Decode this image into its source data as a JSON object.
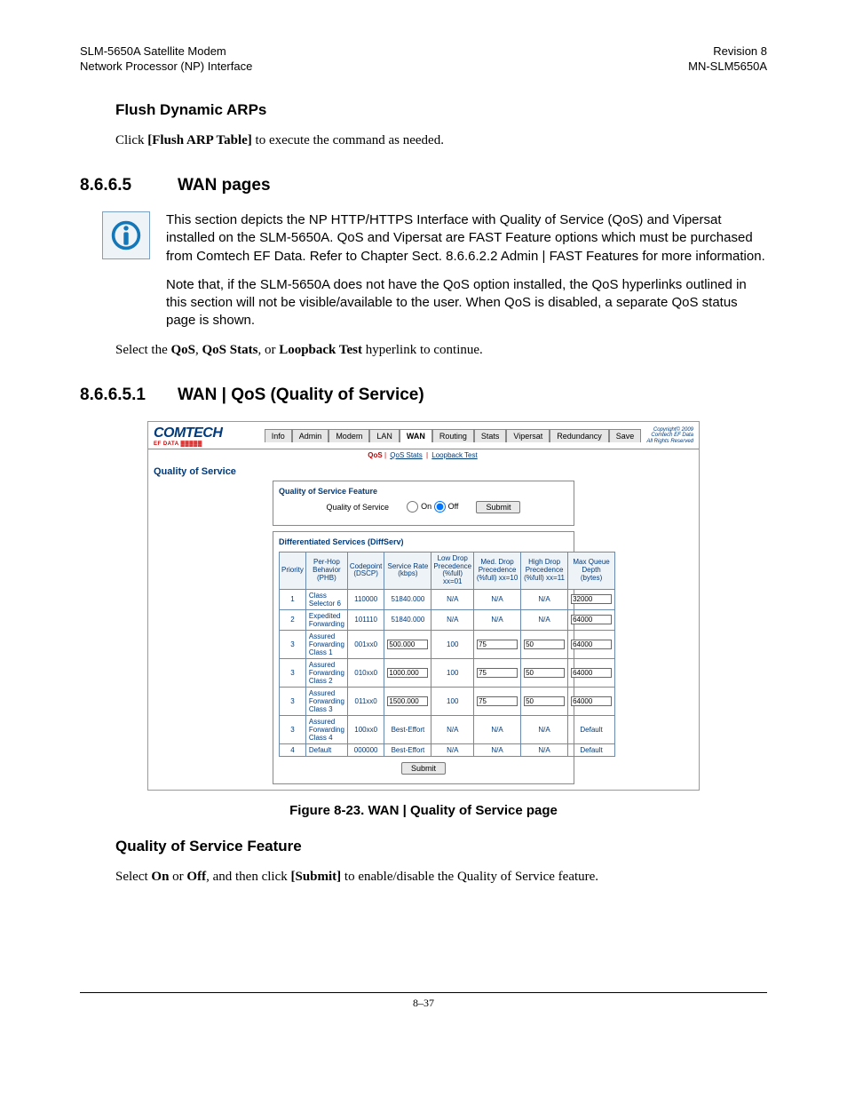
{
  "header": {
    "left1": "SLM-5650A Satellite Modem",
    "left2": "Network Processor (NP) Interface",
    "right1": "Revision 8",
    "right2": "MN-SLM5650A"
  },
  "sec1": {
    "h_flush": "Flush Dynamic ARPs",
    "p_flush_a": "Click ",
    "p_flush_b": "[Flush ARP Table]",
    "p_flush_c": " to execute the command as needed."
  },
  "sec2": {
    "num": "8.6.6.5",
    "title": "WAN pages",
    "info1": "This section depicts the NP HTTP/HTTPS Interface with Quality of Service (QoS) and Vipersat installed on the SLM-5650A. QoS and Vipersat are FAST Feature options which must be purchased from Comtech EF Data. Refer to Chapter Sect. 8.6.6.2.2 Admin | FAST Features for more information.",
    "info2": "Note that, if the SLM-5650A does not have the QoS option installed, the QoS hyperlinks outlined in this section will not be visible/available to the user. When QoS is disabled, a separate QoS status page is shown.",
    "select_a": "Select the ",
    "select_b": "QoS",
    "select_c": ", ",
    "select_d": "QoS Stats",
    "select_e": ", or ",
    "select_f": "Loopback Test",
    "select_g": " hyperlink to continue."
  },
  "sec3": {
    "num": "8.6.6.5.1",
    "title": "WAN | QoS (Quality of Service)"
  },
  "ss": {
    "logo": "COMTECH",
    "logo_sub": "EF DATA ▓▓▓▓▓",
    "tabs": [
      "Info",
      "Admin",
      "Modem",
      "LAN",
      "WAN",
      "Routing",
      "Stats",
      "Vipersat",
      "Redundancy",
      "Save"
    ],
    "active_tab": "WAN",
    "copy1": "Copyright© 2009",
    "copy2": "Comtech EF Data",
    "copy3": "All Rights Reserved",
    "subnav": {
      "active": "QoS",
      "links": [
        "QoS Stats",
        "Loopback Test"
      ]
    },
    "qos_title": "Quality of Service",
    "feature": {
      "heading": "Quality of Service Feature",
      "label": "Quality of Service",
      "on": "On",
      "off": "Off",
      "submit": "Submit"
    },
    "diffserv": {
      "heading": "Differentiated Services (DiffServ)",
      "cols": [
        "Priority",
        "Per-Hop Behavior (PHB)",
        "Codepoint (DSCP)",
        "Service Rate (kbps)",
        "Low Drop Precedence (%full) xx=01",
        "Med. Drop Precedence (%full) xx=10",
        "High Drop Precedence (%full) xx=11",
        "Max Queue Depth (bytes)"
      ],
      "rows": [
        {
          "pri": "1",
          "phb": "Class Selector 6",
          "dscp": "110000",
          "rate": "51840.000",
          "rate_edit": false,
          "low": "N/A",
          "med": "N/A",
          "high": "N/A",
          "depth": "32000",
          "depth_edit": true
        },
        {
          "pri": "2",
          "phb": "Expedited Forwarding",
          "dscp": "101110",
          "rate": "51840.000",
          "rate_edit": false,
          "low": "N/A",
          "med": "N/A",
          "high": "N/A",
          "depth": "64000",
          "depth_edit": true
        },
        {
          "pri": "3",
          "phb": "Assured Forwarding Class 1",
          "dscp": "001xx0",
          "rate": "500.000",
          "rate_edit": true,
          "low": "100",
          "med": "75",
          "high": "50",
          "depth": "64000",
          "depth_edit": true,
          "editable_prec": true
        },
        {
          "pri": "3",
          "phb": "Assured Forwarding Class 2",
          "dscp": "010xx0",
          "rate": "1000.000",
          "rate_edit": true,
          "low": "100",
          "med": "75",
          "high": "50",
          "depth": "64000",
          "depth_edit": true,
          "editable_prec": true
        },
        {
          "pri": "3",
          "phb": "Assured Forwarding Class 3",
          "dscp": "011xx0",
          "rate": "1500.000",
          "rate_edit": true,
          "low": "100",
          "med": "75",
          "high": "50",
          "depth": "64000",
          "depth_edit": true,
          "editable_prec": true
        },
        {
          "pri": "3",
          "phb": "Assured Forwarding Class 4",
          "dscp": "100xx0",
          "rate": "Best-Effort",
          "rate_edit": false,
          "low": "N/A",
          "med": "N/A",
          "high": "N/A",
          "depth": "Default",
          "depth_edit": false
        },
        {
          "pri": "4",
          "phb": "Default",
          "dscp": "000000",
          "rate": "Best-Effort",
          "rate_edit": false,
          "low": "N/A",
          "med": "N/A",
          "high": "N/A",
          "depth": "Default",
          "depth_edit": false
        }
      ],
      "submit": "Submit"
    }
  },
  "figcap": "Figure 8-23. WAN | Quality of Service page",
  "sec4": {
    "h": "Quality of Service Feature",
    "a": "Select ",
    "b": "On",
    "c": " or ",
    "d": "Off",
    "e": ", and then click ",
    "f": "[Submit]",
    "g": " to enable/disable the Quality of Service feature."
  },
  "pagenum": "8–37"
}
